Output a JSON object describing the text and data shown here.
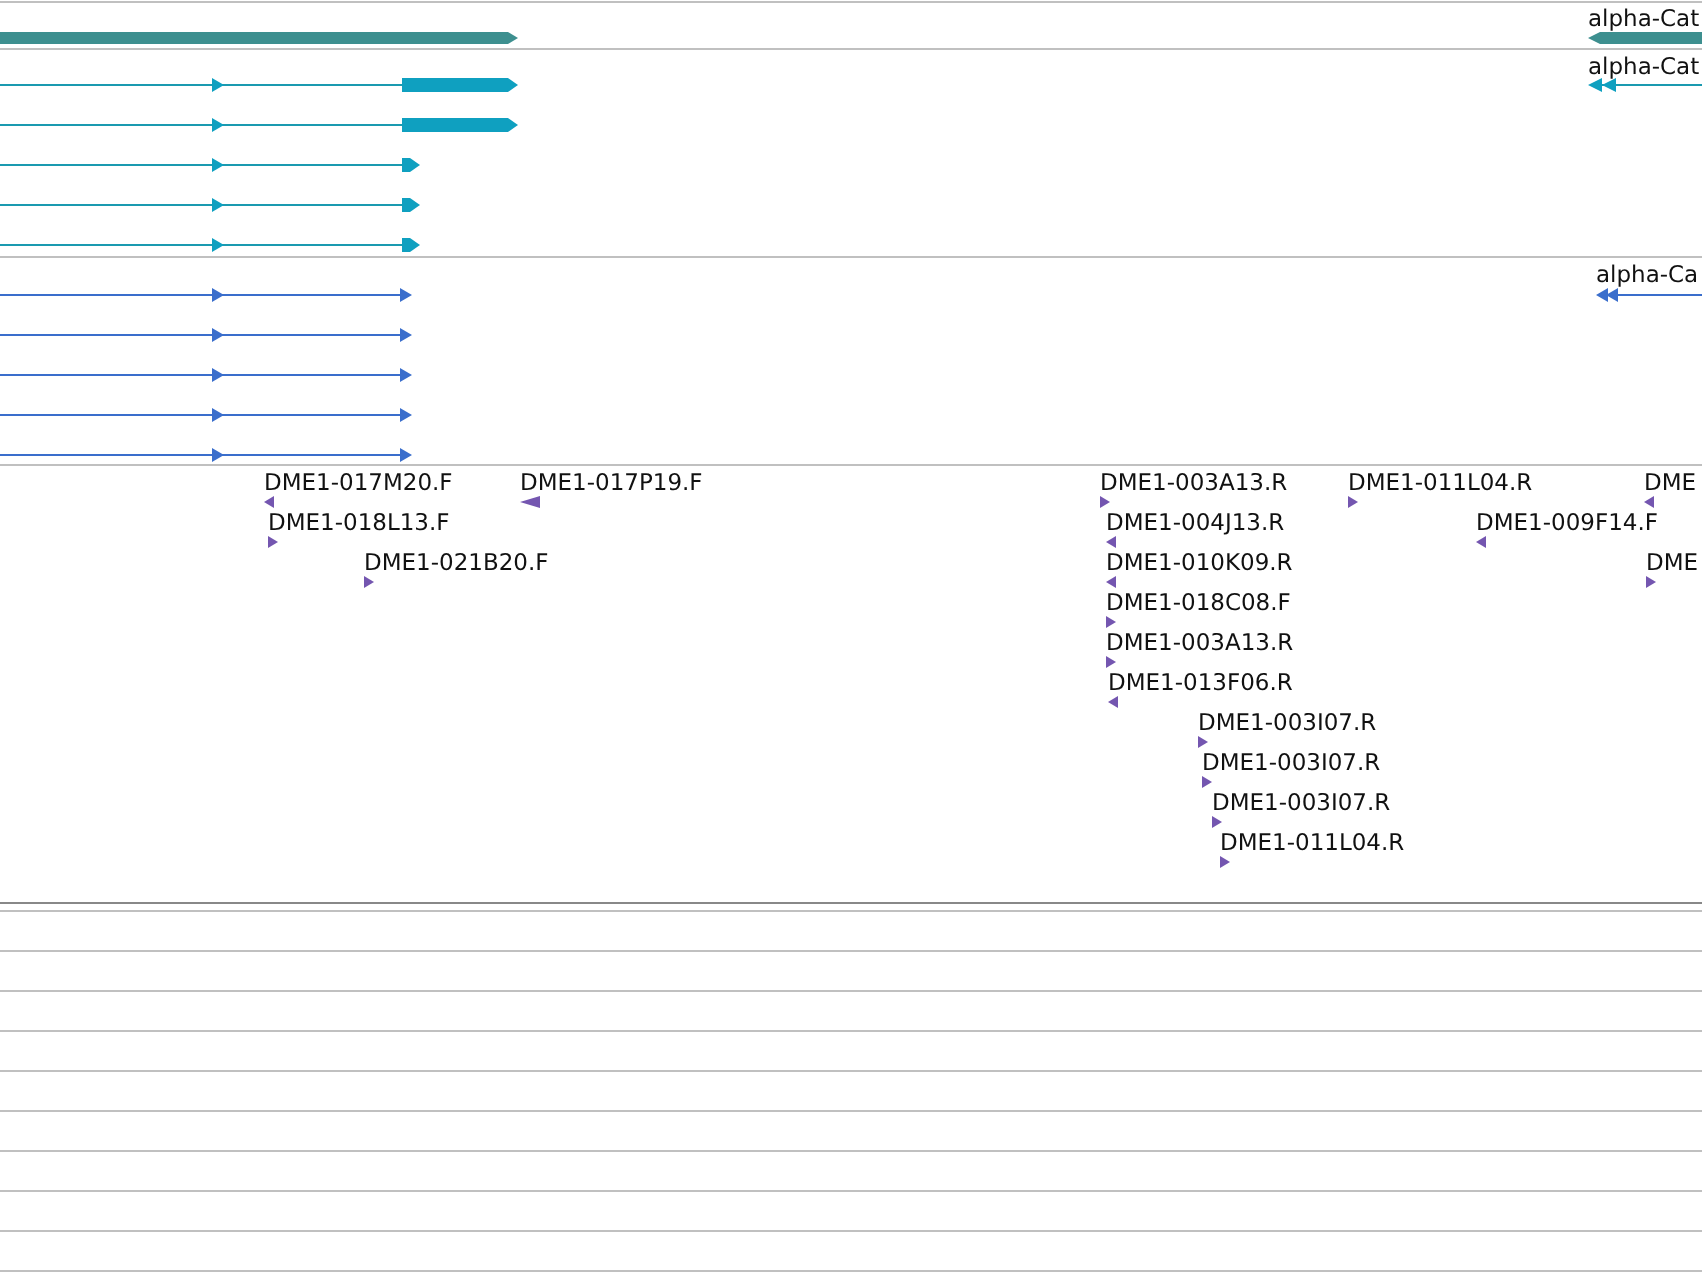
{
  "track_1": {
    "feature_label": "alpha-Cat"
  },
  "track_2": {
    "feature_label": "alpha-Cat"
  },
  "track_3": {
    "feature_label": "alpha-Ca"
  },
  "read_track": {
    "reads": [
      {
        "label": "DME1-017M20.F",
        "reverse": true
      },
      {
        "label": "DME1-017P19.F",
        "reverse": true
      },
      {
        "label": "DME1-003A13.R",
        "reverse": false
      },
      {
        "label": "DME1-011L04.R",
        "reverse": false
      },
      {
        "label": "DME",
        "reverse": true
      },
      {
        "label": "DME1-018L13.F",
        "reverse": false
      },
      {
        "label": "DME1-004J13.R",
        "reverse": true
      },
      {
        "label": "DME1-009F14.F",
        "reverse": true
      },
      {
        "label": "DME1-021B20.F",
        "reverse": false
      },
      {
        "label": "DME1-010K09.R",
        "reverse": true
      },
      {
        "label": "DME",
        "reverse": false
      },
      {
        "label": "DME1-018C08.F",
        "reverse": false
      },
      {
        "label": "DME1-003A13.R",
        "reverse": false
      },
      {
        "label": "DME1-013F06.R",
        "reverse": true
      },
      {
        "label": "DME1-003I07.R",
        "reverse": false
      },
      {
        "label": "DME1-003I07.R",
        "reverse": false
      },
      {
        "label": "DME1-003I07.R",
        "reverse": false
      },
      {
        "label": "DME1-011L04.R",
        "reverse": false
      }
    ]
  }
}
